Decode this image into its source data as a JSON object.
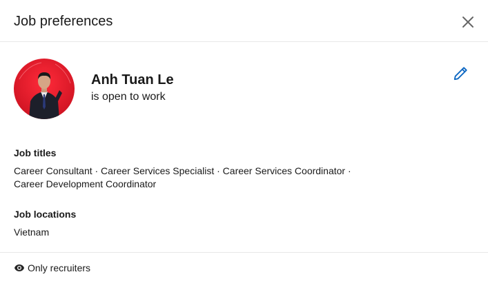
{
  "header": {
    "title": "Job preferences",
    "close_icon": "close-icon"
  },
  "profile": {
    "name": "Anh Tuan Le",
    "status": "is open to work",
    "edit_icon": "pencil-icon",
    "accent_color": "#0a66c2"
  },
  "sections": {
    "job_titles": {
      "label": "Job titles",
      "line1": "Career Consultant · Career Services Specialist · Career Services Coordinator ·",
      "line2": "Career Development Coordinator"
    },
    "job_locations": {
      "label": "Job locations",
      "value": "Vietnam"
    }
  },
  "footer": {
    "visibility_icon": "eye-icon",
    "visibility_label": "Only recruiters"
  }
}
